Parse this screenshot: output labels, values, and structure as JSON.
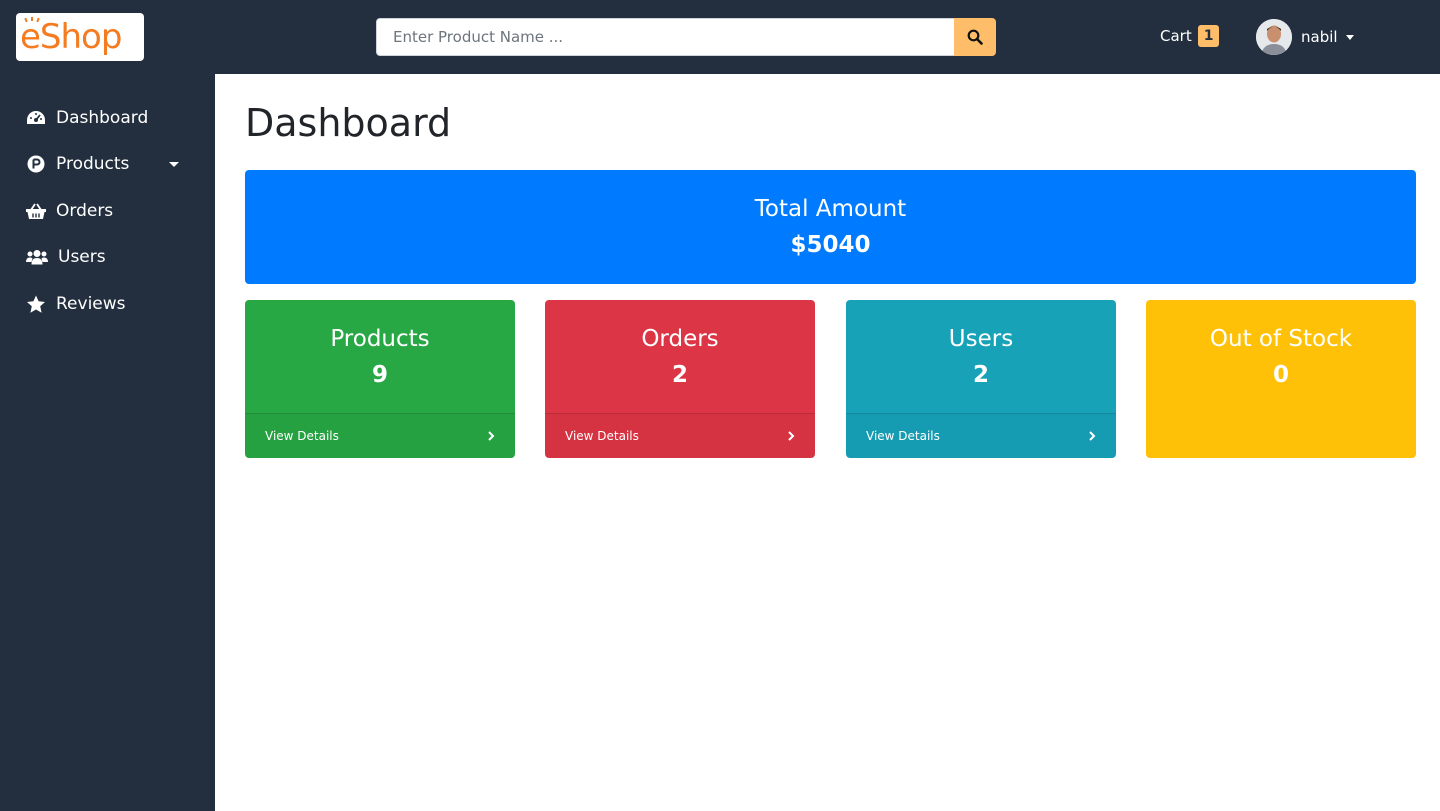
{
  "header": {
    "logo_text": "eShop",
    "search": {
      "placeholder": "Enter Product Name ...",
      "value": ""
    },
    "search_icon": "search-icon",
    "cart": {
      "label": "Cart",
      "count": "1"
    },
    "user": {
      "name": "nabil"
    }
  },
  "sidebar": {
    "items": [
      {
        "label": "Dashboard",
        "icon": "tachometer-icon"
      },
      {
        "label": "Products",
        "icon": "product-hunt-icon"
      },
      {
        "label": "Orders",
        "icon": "shopping-basket-icon"
      },
      {
        "label": "Users",
        "icon": "users-icon"
      },
      {
        "label": "Reviews",
        "icon": "star-icon"
      }
    ]
  },
  "main": {
    "title": "Dashboard",
    "total": {
      "label": "Total Amount",
      "value": "$5040"
    },
    "cards": [
      {
        "label": "Products",
        "value": "9",
        "footer": "View Details",
        "color": "#28a745"
      },
      {
        "label": "Orders",
        "value": "2",
        "footer": "View Details",
        "color": "#dc3545"
      },
      {
        "label": "Users",
        "value": "2",
        "footer": "View Details",
        "color": "#17a2b8"
      },
      {
        "label": "Out of Stock",
        "value": "0",
        "color": "#ffc107"
      }
    ]
  },
  "colors": {
    "nav_bg": "#232f3e",
    "accent": "#febd69",
    "logo": "#f47b20",
    "total_bg": "#007bff"
  }
}
